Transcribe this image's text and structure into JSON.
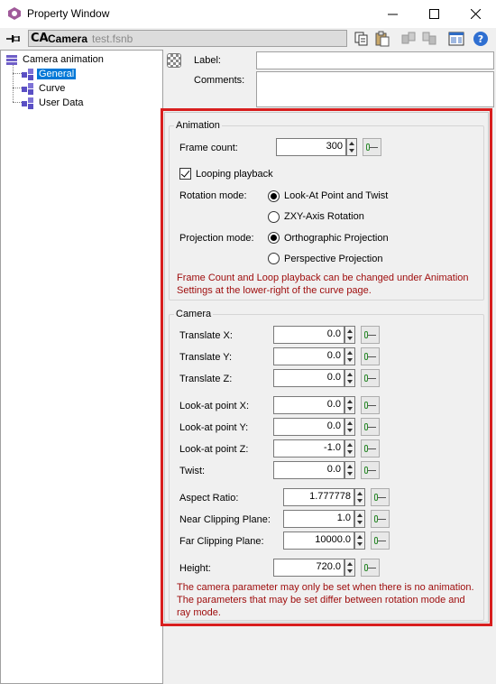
{
  "window": {
    "title": "Property Window"
  },
  "toolbar": {
    "object_icon": "CA",
    "object_name": "Camera",
    "object_file": "test.fsnb"
  },
  "tree": {
    "root": "Camera animation",
    "items": [
      {
        "label": "General",
        "selected": true
      },
      {
        "label": "Curve",
        "selected": false
      },
      {
        "label": "User Data",
        "selected": false
      }
    ]
  },
  "header": {
    "label_label": "Label:",
    "label_value": "",
    "comments_label": "Comments:",
    "comments_value": ""
  },
  "animation": {
    "group_title": "Animation",
    "frame_count_label": "Frame count:",
    "frame_count": "300",
    "looping_label": "Looping playback",
    "looping_checked": true,
    "rotation_mode_label": "Rotation mode:",
    "rotation_options": [
      "Look-At Point and Twist",
      "ZXY-Axis Rotation"
    ],
    "rotation_selected": 0,
    "projection_mode_label": "Projection mode:",
    "projection_options": [
      "Orthographic Projection",
      "Perspective Projection"
    ],
    "projection_selected": 0,
    "note": "Frame Count and Loop playback can be changed under Animation Settings at the lower-right of the curve page."
  },
  "camera": {
    "group_title": "Camera",
    "translate_x_label": "Translate X:",
    "translate_x": "0.0",
    "translate_y_label": "Translate Y:",
    "translate_y": "0.0",
    "translate_z_label": "Translate Z:",
    "translate_z": "0.0",
    "lookat_x_label": "Look-at point X:",
    "lookat_x": "0.0",
    "lookat_y_label": "Look-at point Y:",
    "lookat_y": "0.0",
    "lookat_z_label": "Look-at point Z:",
    "lookat_z": "-1.0",
    "twist_label": "Twist:",
    "twist": "0.0",
    "aspect_label": "Aspect Ratio:",
    "aspect": "1.777778",
    "near_label": "Near Clipping Plane:",
    "near": "1.0",
    "far_label": "Far Clipping Plane:",
    "far": "10000.0",
    "height_label": "Height:",
    "height": "720.0",
    "note": "The camera parameter may only be set when there is no animation. The parameters that may be set differ between rotation mode and ray mode."
  },
  "colors": {
    "highlight_border": "#d81e1e",
    "note_text": "#9e0b0b",
    "selection": "#0078d7"
  }
}
